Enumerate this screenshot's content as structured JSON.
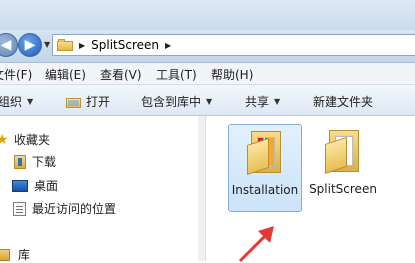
{
  "address_bar": {
    "crumbs": [
      "SplitScreen"
    ]
  },
  "menu": {
    "items": [
      "文件(F)",
      "编辑(E)",
      "查看(V)",
      "工具(T)",
      "帮助(H)"
    ]
  },
  "toolbar": {
    "organize": "组织",
    "open": "打开",
    "include_in_library": "包含到库中",
    "share": "共享",
    "new_folder": "新建文件夹"
  },
  "nav_pane": {
    "favorites": "收藏夹",
    "downloads": "下载",
    "desktop": "桌面",
    "recent": "最近访问的位置",
    "libraries": "库"
  },
  "content": {
    "items": [
      {
        "name": "Installation",
        "selected": true,
        "icon": "folder-with-installer-icon"
      },
      {
        "name": "SplitScreen",
        "selected": false,
        "icon": "folder-icon"
      }
    ]
  },
  "colors": {
    "selection": "#cbe3fb",
    "arrow": "#e53935"
  }
}
